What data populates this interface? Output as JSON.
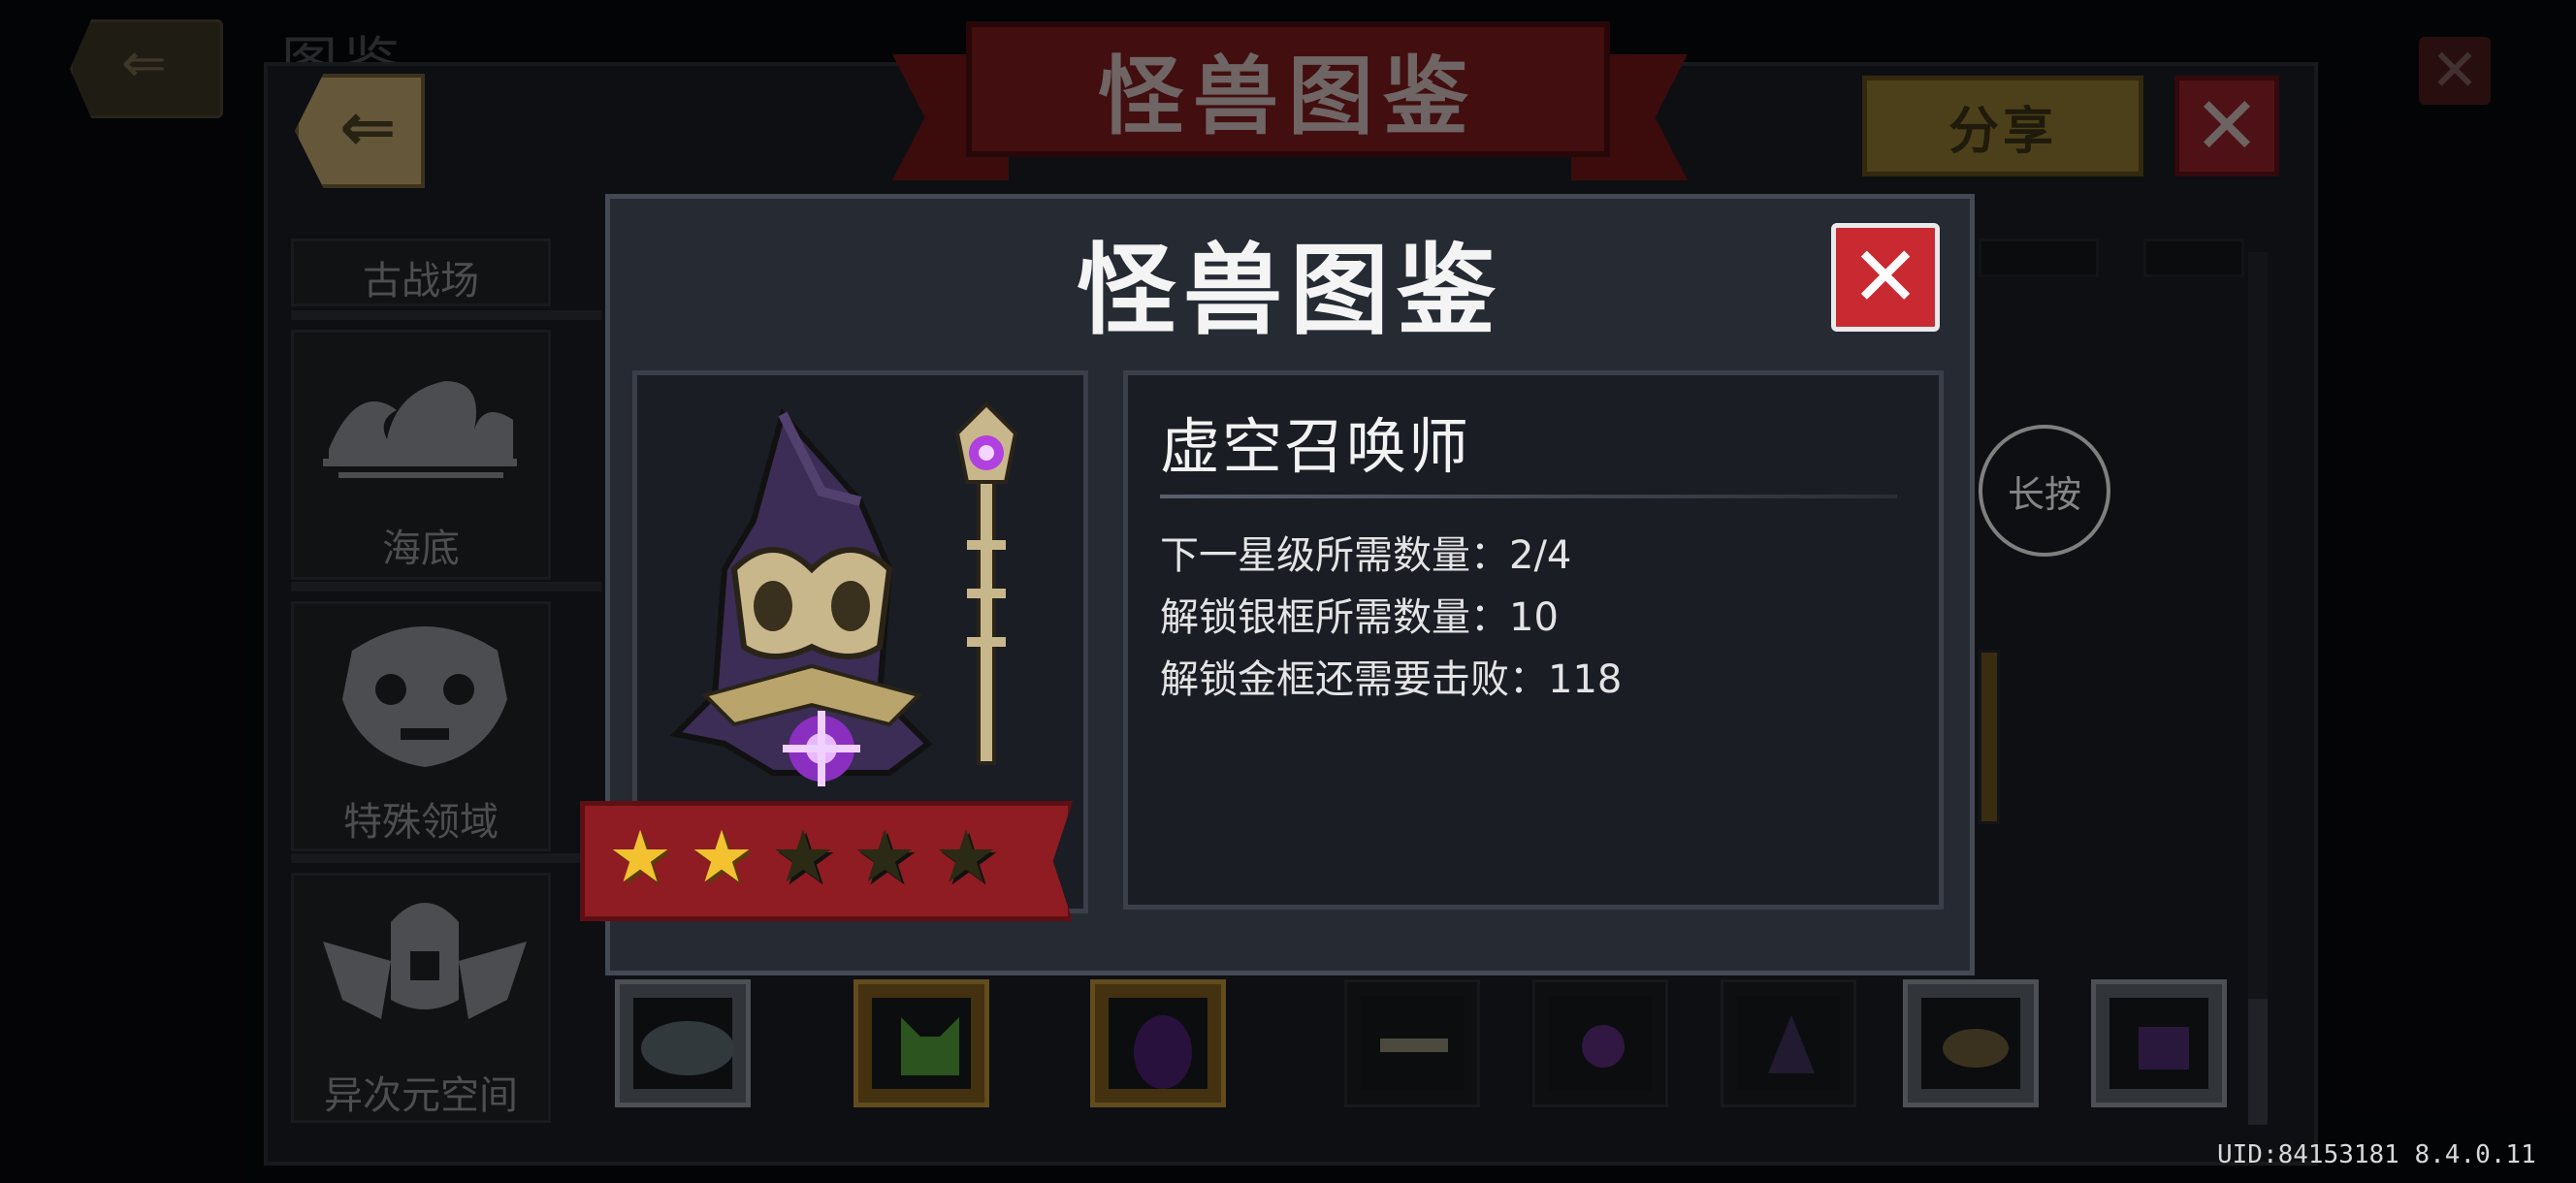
{
  "background": {
    "title_partial": "图鉴"
  },
  "header": {
    "title": "怪兽图鉴",
    "share_label": "分享"
  },
  "sidebar": {
    "items": [
      {
        "label": "古战场",
        "icon": "battlefield-icon"
      },
      {
        "label": "海底",
        "icon": "waves-icon"
      },
      {
        "label": "特殊领域",
        "icon": "lion-mask-icon"
      },
      {
        "label": "异次元空间",
        "icon": "winged-helmet-icon"
      }
    ]
  },
  "hint": {
    "long_press": "长按"
  },
  "modal": {
    "title": "怪兽图鉴",
    "monster_name": "虚空召唤师",
    "stars_total": 5,
    "stars_filled": 2,
    "stats": [
      {
        "label": "下一星级所需数量：",
        "value": "2/4"
      },
      {
        "label": "解锁银框所需数量：",
        "value": "10"
      },
      {
        "label": "解锁金框还需要击败：",
        "value": "118"
      }
    ]
  },
  "footer": {
    "uid": "UID:84153181 8.4.0.11"
  },
  "colors": {
    "banner_red": "#7b1a1d",
    "close_red": "#c92a32",
    "share_gold": "#8a7530",
    "star_gold": "#f2c230",
    "void_purple": "#b040e0"
  }
}
